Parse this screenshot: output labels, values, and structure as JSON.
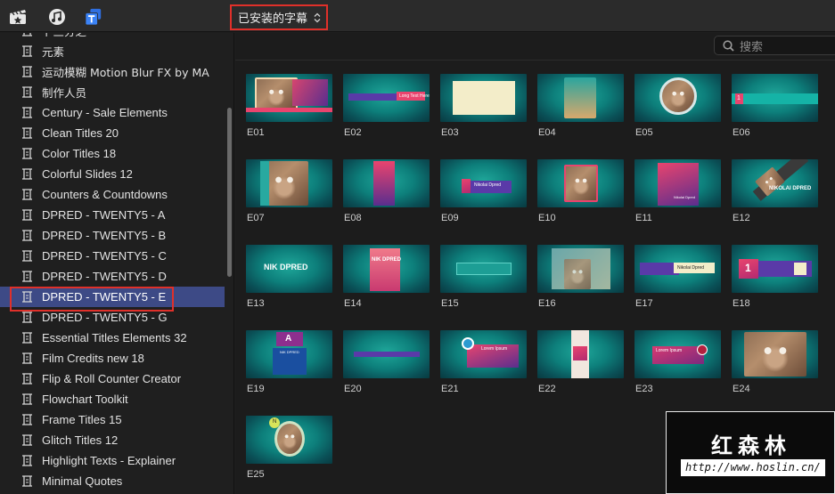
{
  "toolbar": {
    "icons": [
      "clapper-star-icon",
      "music-notes-icon",
      "titles-t-icon"
    ],
    "dropdown_label": "已安装的字幕",
    "accent_color": "#3b83f6"
  },
  "sidebar": {
    "items": [
      {
        "label": "卜三分之一"
      },
      {
        "label": "元素"
      },
      {
        "label": "运动模糊 Motion Blur FX by MA"
      },
      {
        "label": "制作人员"
      },
      {
        "label": "Century - Sale Elements"
      },
      {
        "label": "Clean Titles 20"
      },
      {
        "label": "Color Titles 18"
      },
      {
        "label": "Colorful Slides 12"
      },
      {
        "label": "Counters & Countdowns"
      },
      {
        "label": "DPRED - TWENTY5 - A"
      },
      {
        "label": "DPRED - TWENTY5 - B"
      },
      {
        "label": "DPRED - TWENTY5 - C"
      },
      {
        "label": "DPRED - TWENTY5 - D"
      },
      {
        "label": "DPRED - TWENTY5 - E",
        "selected": true
      },
      {
        "label": "DPRED - TWENTY5 - G"
      },
      {
        "label": "Essential Titles Elements 32"
      },
      {
        "label": "Film Credits new 18"
      },
      {
        "label": "Flip & Roll Counter Creator"
      },
      {
        "label": "Flowchart Toolkit"
      },
      {
        "label": "Frame Titles 15"
      },
      {
        "label": "Glitch Titles 12"
      },
      {
        "label": "Highlight Texts - Explainer"
      },
      {
        "label": "Minimal Quotes"
      }
    ],
    "selected_color": "#3d4a86"
  },
  "search": {
    "placeholder": "搜索"
  },
  "tiles": [
    {
      "label": "E01"
    },
    {
      "label": "E02"
    },
    {
      "label": "E03"
    },
    {
      "label": "E04"
    },
    {
      "label": "E05"
    },
    {
      "label": "E06"
    },
    {
      "label": "E07"
    },
    {
      "label": "E08"
    },
    {
      "label": "E09"
    },
    {
      "label": "E10"
    },
    {
      "label": "E11"
    },
    {
      "label": "E12"
    },
    {
      "label": "E13"
    },
    {
      "label": "E14"
    },
    {
      "label": "E15"
    },
    {
      "label": "E16"
    },
    {
      "label": "E17"
    },
    {
      "label": "E18"
    },
    {
      "label": "E19"
    },
    {
      "label": "E20"
    },
    {
      "label": "E21"
    },
    {
      "label": "E22"
    },
    {
      "label": "E23"
    },
    {
      "label": "E24"
    },
    {
      "label": "E25"
    }
  ],
  "thumb_text": {
    "e02_tag": "Long Text Here",
    "e09_name": "Nikolai Dpred",
    "e11_role": "Nikolai Dpred",
    "e12_name": "NIKOLAI DPRED",
    "e13_name": "NIK DPRED",
    "e14_name": "NIK DPRED",
    "e17_tag": "Nikolai Dpred",
    "e18_number": "1",
    "e19_letter": "A",
    "e19_name": "NIK DPRED",
    "e21_title": "Lorem Ipsum",
    "e23_title": "Lorem Ipsum",
    "e25_letter": "N",
    "e06_number": "1"
  },
  "watermark": {
    "title": "红森林",
    "url": "http://www.hoslin.cn/"
  }
}
